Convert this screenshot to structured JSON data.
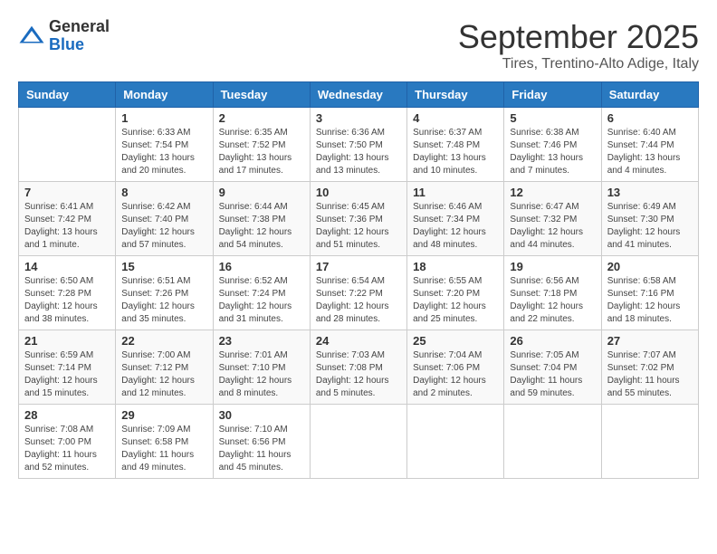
{
  "header": {
    "logo_general": "General",
    "logo_blue": "Blue",
    "month_title": "September 2025",
    "location": "Tires, Trentino-Alto Adige, Italy"
  },
  "days_of_week": [
    "Sunday",
    "Monday",
    "Tuesday",
    "Wednesday",
    "Thursday",
    "Friday",
    "Saturday"
  ],
  "weeks": [
    [
      {
        "day": "",
        "info": ""
      },
      {
        "day": "1",
        "info": "Sunrise: 6:33 AM\nSunset: 7:54 PM\nDaylight: 13 hours\nand 20 minutes."
      },
      {
        "day": "2",
        "info": "Sunrise: 6:35 AM\nSunset: 7:52 PM\nDaylight: 13 hours\nand 17 minutes."
      },
      {
        "day": "3",
        "info": "Sunrise: 6:36 AM\nSunset: 7:50 PM\nDaylight: 13 hours\nand 13 minutes."
      },
      {
        "day": "4",
        "info": "Sunrise: 6:37 AM\nSunset: 7:48 PM\nDaylight: 13 hours\nand 10 minutes."
      },
      {
        "day": "5",
        "info": "Sunrise: 6:38 AM\nSunset: 7:46 PM\nDaylight: 13 hours\nand 7 minutes."
      },
      {
        "day": "6",
        "info": "Sunrise: 6:40 AM\nSunset: 7:44 PM\nDaylight: 13 hours\nand 4 minutes."
      }
    ],
    [
      {
        "day": "7",
        "info": "Sunrise: 6:41 AM\nSunset: 7:42 PM\nDaylight: 13 hours\nand 1 minute."
      },
      {
        "day": "8",
        "info": "Sunrise: 6:42 AM\nSunset: 7:40 PM\nDaylight: 12 hours\nand 57 minutes."
      },
      {
        "day": "9",
        "info": "Sunrise: 6:44 AM\nSunset: 7:38 PM\nDaylight: 12 hours\nand 54 minutes."
      },
      {
        "day": "10",
        "info": "Sunrise: 6:45 AM\nSunset: 7:36 PM\nDaylight: 12 hours\nand 51 minutes."
      },
      {
        "day": "11",
        "info": "Sunrise: 6:46 AM\nSunset: 7:34 PM\nDaylight: 12 hours\nand 48 minutes."
      },
      {
        "day": "12",
        "info": "Sunrise: 6:47 AM\nSunset: 7:32 PM\nDaylight: 12 hours\nand 44 minutes."
      },
      {
        "day": "13",
        "info": "Sunrise: 6:49 AM\nSunset: 7:30 PM\nDaylight: 12 hours\nand 41 minutes."
      }
    ],
    [
      {
        "day": "14",
        "info": "Sunrise: 6:50 AM\nSunset: 7:28 PM\nDaylight: 12 hours\nand 38 minutes."
      },
      {
        "day": "15",
        "info": "Sunrise: 6:51 AM\nSunset: 7:26 PM\nDaylight: 12 hours\nand 35 minutes."
      },
      {
        "day": "16",
        "info": "Sunrise: 6:52 AM\nSunset: 7:24 PM\nDaylight: 12 hours\nand 31 minutes."
      },
      {
        "day": "17",
        "info": "Sunrise: 6:54 AM\nSunset: 7:22 PM\nDaylight: 12 hours\nand 28 minutes."
      },
      {
        "day": "18",
        "info": "Sunrise: 6:55 AM\nSunset: 7:20 PM\nDaylight: 12 hours\nand 25 minutes."
      },
      {
        "day": "19",
        "info": "Sunrise: 6:56 AM\nSunset: 7:18 PM\nDaylight: 12 hours\nand 22 minutes."
      },
      {
        "day": "20",
        "info": "Sunrise: 6:58 AM\nSunset: 7:16 PM\nDaylight: 12 hours\nand 18 minutes."
      }
    ],
    [
      {
        "day": "21",
        "info": "Sunrise: 6:59 AM\nSunset: 7:14 PM\nDaylight: 12 hours\nand 15 minutes."
      },
      {
        "day": "22",
        "info": "Sunrise: 7:00 AM\nSunset: 7:12 PM\nDaylight: 12 hours\nand 12 minutes."
      },
      {
        "day": "23",
        "info": "Sunrise: 7:01 AM\nSunset: 7:10 PM\nDaylight: 12 hours\nand 8 minutes."
      },
      {
        "day": "24",
        "info": "Sunrise: 7:03 AM\nSunset: 7:08 PM\nDaylight: 12 hours\nand 5 minutes."
      },
      {
        "day": "25",
        "info": "Sunrise: 7:04 AM\nSunset: 7:06 PM\nDaylight: 12 hours\nand 2 minutes."
      },
      {
        "day": "26",
        "info": "Sunrise: 7:05 AM\nSunset: 7:04 PM\nDaylight: 11 hours\nand 59 minutes."
      },
      {
        "day": "27",
        "info": "Sunrise: 7:07 AM\nSunset: 7:02 PM\nDaylight: 11 hours\nand 55 minutes."
      }
    ],
    [
      {
        "day": "28",
        "info": "Sunrise: 7:08 AM\nSunset: 7:00 PM\nDaylight: 11 hours\nand 52 minutes."
      },
      {
        "day": "29",
        "info": "Sunrise: 7:09 AM\nSunset: 6:58 PM\nDaylight: 11 hours\nand 49 minutes."
      },
      {
        "day": "30",
        "info": "Sunrise: 7:10 AM\nSunset: 6:56 PM\nDaylight: 11 hours\nand 45 minutes."
      },
      {
        "day": "",
        "info": ""
      },
      {
        "day": "",
        "info": ""
      },
      {
        "day": "",
        "info": ""
      },
      {
        "day": "",
        "info": ""
      }
    ]
  ]
}
